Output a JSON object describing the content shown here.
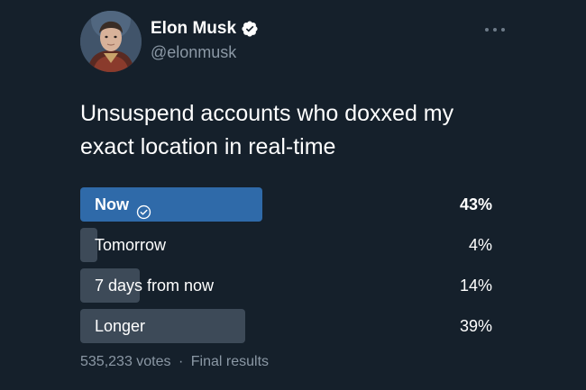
{
  "author": {
    "display_name": "Elon Musk",
    "handle": "@elonmusk",
    "verified": true,
    "verified_icon": "verified-badge-icon"
  },
  "tweet": {
    "text": "Unsuspend accounts who doxxed my exact location in real-time"
  },
  "poll": {
    "options": [
      {
        "label": "Now",
        "percent_label": "43%",
        "percent": 43,
        "winner": true
      },
      {
        "label": "Tomorrow",
        "percent_label": "4%",
        "percent": 4,
        "winner": false
      },
      {
        "label": "7 days from now",
        "percent_label": "14%",
        "percent": 14,
        "winner": false
      },
      {
        "label": "Longer",
        "percent_label": "39%",
        "percent": 39,
        "winner": false
      }
    ],
    "votes": "535,233 votes",
    "separator": "·",
    "status": "Final results"
  },
  "colors": {
    "background": "#15202b",
    "winner_bar": "#2f6aa9",
    "bar": "#3d4a58",
    "secondary_text": "#8b98a5",
    "verified_badge": "#ffffff"
  }
}
